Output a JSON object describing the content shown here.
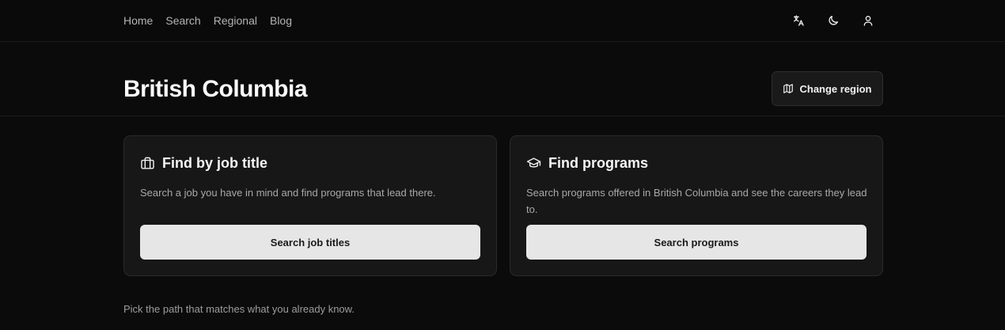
{
  "nav": {
    "items": [
      {
        "label": "Home"
      },
      {
        "label": "Search"
      },
      {
        "label": "Regional"
      },
      {
        "label": "Blog"
      }
    ]
  },
  "top_actions": [
    {
      "icon": "translate-icon"
    },
    {
      "icon": "moon-icon"
    },
    {
      "icon": "user-icon"
    }
  ],
  "page": {
    "title": "British Columbia",
    "change_region_label": "Change region"
  },
  "cards": [
    {
      "icon": "briefcase-icon",
      "title": "Find by job title",
      "description": "Search a job you have in mind and find programs that lead there.",
      "button_label": "Search job titles"
    },
    {
      "icon": "graduation-cap-icon",
      "title": "Find programs",
      "description": "Search programs offered in British Columbia and see the careers they lead to.",
      "button_label": "Search programs"
    }
  ],
  "footer_hint": "Pick the path that matches what you already know."
}
